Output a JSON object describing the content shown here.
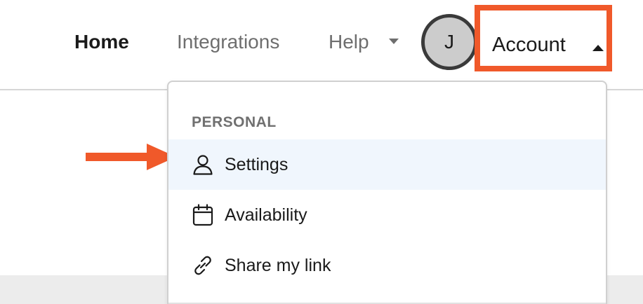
{
  "nav": {
    "home": "Home",
    "integrations": "Integrations",
    "help": "Help",
    "avatar_initial": "J",
    "account": "Account"
  },
  "dropdown": {
    "section_label": "PERSONAL",
    "items": [
      {
        "label": "Settings",
        "icon": "user-icon",
        "selected": true
      },
      {
        "label": "Availability",
        "icon": "calendar-icon",
        "selected": false
      },
      {
        "label": "Share my link",
        "icon": "link-icon",
        "selected": false
      }
    ]
  },
  "colors": {
    "highlight": "#f0592a",
    "selected_bg": "#f0f6fd",
    "avatar_bg": "#cccccc"
  }
}
